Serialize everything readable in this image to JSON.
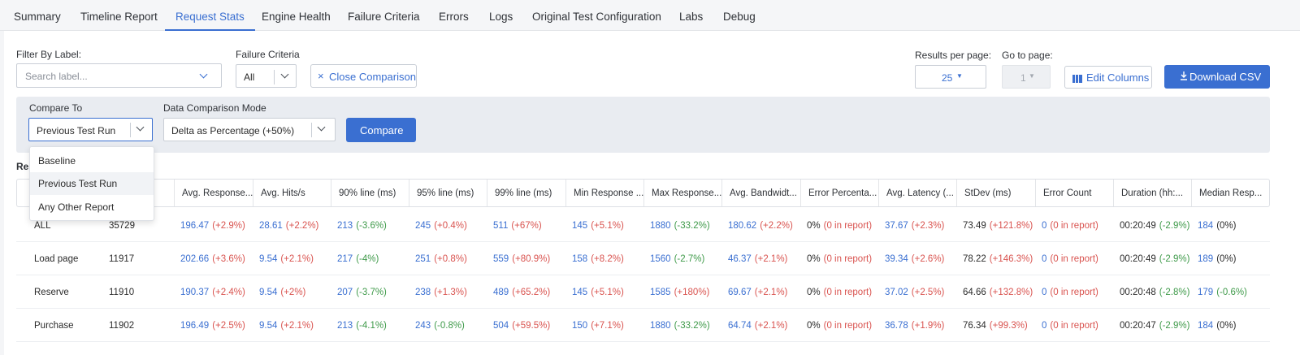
{
  "tabs": [
    "Summary",
    "Timeline Report",
    "Request Stats",
    "Engine Health",
    "Failure Criteria",
    "Errors",
    "Logs",
    "Original Test Configuration",
    "Labs",
    "Debug"
  ],
  "active_tab": "Request Stats",
  "filter": {
    "label": "Filter By Label:",
    "placeholder": "Search label...",
    "failure_label": "Failure Criteria",
    "failure_value": "All",
    "close_comparison": "Close Comparison"
  },
  "paging": {
    "results_label": "Results per page:",
    "results_value": "25",
    "goto_label": "Go to page:",
    "goto_value": "1",
    "edit_columns": "Edit Columns",
    "download_csv": "Download CSV"
  },
  "compare": {
    "compare_to_label": "Compare To",
    "compare_to_value": "Previous Test Run",
    "mode_label": "Data Comparison Mode",
    "mode_value": "Delta as Percentage (+50%)",
    "compare_button": "Compare",
    "options": [
      "Baseline",
      "Previous Test Run",
      "Any Other Report"
    ],
    "selected_option": "Previous Test Run"
  },
  "results_heading": "Res",
  "table": {
    "columns": [
      "",
      "",
      "Avg. Response...",
      "Avg. Hits/s",
      "90% line (ms)",
      "95% line (ms)",
      "99% line (ms)",
      "Min Response ...",
      "Max Response...",
      "Avg. Bandwidt...",
      "Error Percenta...",
      "Avg. Latency (...",
      "StDev (ms)",
      "Error Count",
      "Duration (hh:...",
      "Median Resp..."
    ],
    "rows": [
      {
        "label": "ALL",
        "samples": "35729",
        "cells": [
          [
            "196.47",
            "(+2.9%)"
          ],
          [
            "28.61",
            "(+2.2%)"
          ],
          [
            "213",
            "(-3.6%)"
          ],
          [
            "245",
            "(+0.4%)"
          ],
          [
            "511",
            "(+67%)"
          ],
          [
            "145",
            "(+5.1%)"
          ],
          [
            "1880",
            "(-33.2%)"
          ],
          [
            "180.62",
            "(+2.2%)"
          ],
          [
            "0%",
            "(0 in report)"
          ],
          [
            "37.67",
            "(+2.3%)"
          ],
          [
            "73.49",
            "(+121.8%)"
          ],
          [
            "0",
            "(0 in report)"
          ],
          [
            "00:20:49",
            "(-2.9%)"
          ],
          [
            "184",
            "(0%)"
          ]
        ]
      },
      {
        "label": "Load page",
        "samples": "11917",
        "cells": [
          [
            "202.66",
            "(+3.6%)"
          ],
          [
            "9.54",
            "(+2.1%)"
          ],
          [
            "217",
            "(-4%)"
          ],
          [
            "251",
            "(+0.8%)"
          ],
          [
            "559",
            "(+80.9%)"
          ],
          [
            "158",
            "(+8.2%)"
          ],
          [
            "1560",
            "(-2.7%)"
          ],
          [
            "46.37",
            "(+2.1%)"
          ],
          [
            "0%",
            "(0 in report)"
          ],
          [
            "39.34",
            "(+2.6%)"
          ],
          [
            "78.22",
            "(+146.3%)"
          ],
          [
            "0",
            "(0 in report)"
          ],
          [
            "00:20:49",
            "(-2.9%)"
          ],
          [
            "189",
            "(0%)"
          ]
        ]
      },
      {
        "label": "Reserve",
        "samples": "11910",
        "cells": [
          [
            "190.37",
            "(+2.4%)"
          ],
          [
            "9.54",
            "(+2%)"
          ],
          [
            "207",
            "(-3.7%)"
          ],
          [
            "238",
            "(+1.3%)"
          ],
          [
            "489",
            "(+65.2%)"
          ],
          [
            "145",
            "(+5.1%)"
          ],
          [
            "1585",
            "(+180%)"
          ],
          [
            "69.67",
            "(+2.1%)"
          ],
          [
            "0%",
            "(0 in report)"
          ],
          [
            "37.02",
            "(+2.5%)"
          ],
          [
            "64.66",
            "(+132.8%)"
          ],
          [
            "0",
            "(0 in report)"
          ],
          [
            "00:20:48",
            "(-2.8%)"
          ],
          [
            "179",
            "(-0.6%)"
          ]
        ]
      },
      {
        "label": "Purchase",
        "samples": "11902",
        "cells": [
          [
            "196.49",
            "(+2.5%)"
          ],
          [
            "9.54",
            "(+2.1%)"
          ],
          [
            "213",
            "(-4.1%)"
          ],
          [
            "243",
            "(-0.8%)"
          ],
          [
            "504",
            "(+59.5%)"
          ],
          [
            "150",
            "(+7.1%)"
          ],
          [
            "1880",
            "(-33.2%)"
          ],
          [
            "64.74",
            "(+2.1%)"
          ],
          [
            "0%",
            "(0 in report)"
          ],
          [
            "36.78",
            "(+1.9%)"
          ],
          [
            "76.34",
            "(+99.3%)"
          ],
          [
            "0",
            "(0 in report)"
          ],
          [
            "00:20:47",
            "(-2.9%)"
          ],
          [
            "184",
            "(0%)"
          ]
        ]
      }
    ]
  },
  "colors": {
    "accent": "#3a6fd1",
    "increase": "#d9534f",
    "decrease": "#3f9a4a"
  }
}
